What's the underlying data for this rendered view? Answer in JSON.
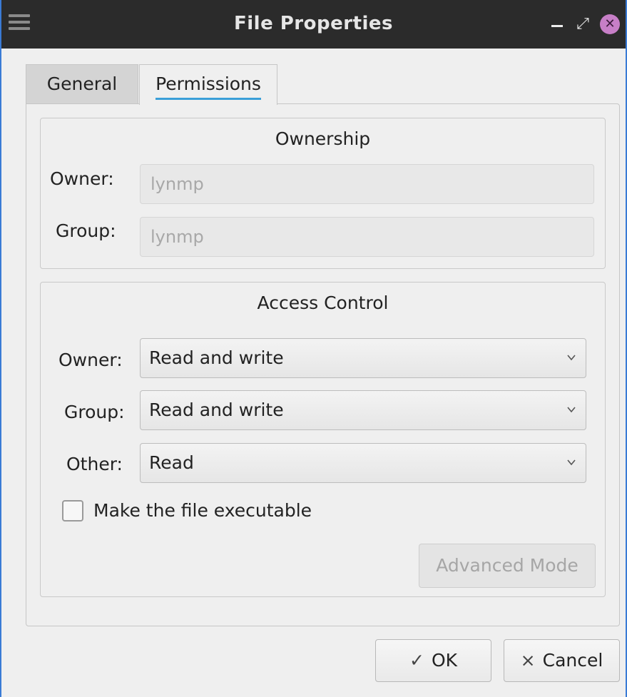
{
  "window": {
    "title": "File Properties",
    "close_glyph": "✕",
    "restore_glyph": "⤢"
  },
  "tabs": [
    {
      "label": "General",
      "active": false
    },
    {
      "label": "Permissions",
      "active": true
    }
  ],
  "ownership": {
    "title": "Ownership",
    "owner_label": "Owner:",
    "owner_value": "lynmp",
    "group_label": "Group:",
    "group_value": "lynmp"
  },
  "access_control": {
    "title": "Access Control",
    "owner_label": "Owner:",
    "owner_value": "Read and write",
    "group_label": "Group:",
    "group_value": "Read and write",
    "other_label": "Other:",
    "other_value": "Read",
    "executable_label": "Make the file executable",
    "executable_checked": false,
    "advanced_label": "Advanced Mode"
  },
  "buttons": {
    "ok_glyph": "✓",
    "ok_label": "OK",
    "cancel_glyph": "×",
    "cancel_label": "Cancel"
  },
  "icons": {
    "menu": "hamburger-menu-icon",
    "minimize": "minimize-icon",
    "restore": "restore-icon",
    "close": "close-icon",
    "chevron": "chevron-down-icon"
  },
  "colors": {
    "titlebar": "#2b2b2b",
    "accent": "#3a9fd8",
    "close": "#c77fc7"
  }
}
